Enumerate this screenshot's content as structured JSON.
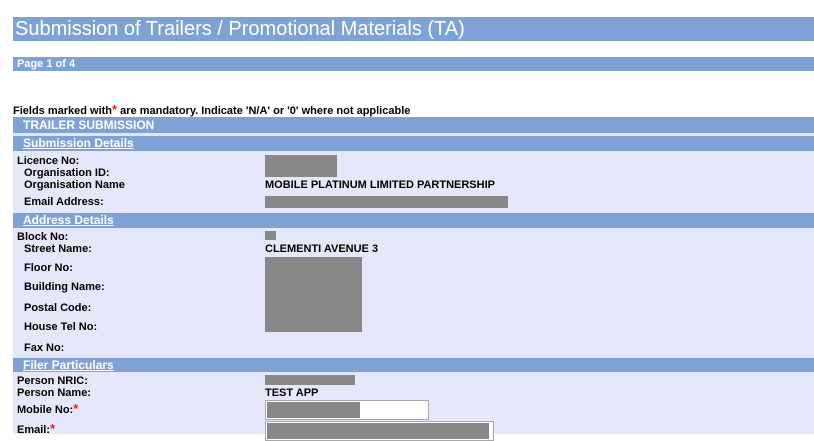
{
  "title": "Submission of Trailers / Promotional Materials (TA)",
  "page_indicator": "Page 1 of 4",
  "mandatory_note": {
    "prefix": "Fields marked with",
    "star": "*",
    "suffix": " are mandatory. Indicate 'N/A' or '0' where not applicable"
  },
  "section_title": "TRAILER SUBMISSION",
  "submission_details": {
    "header": "Submission Details",
    "labels": {
      "licence_no": "Licence No:",
      "organisation_id": "Organisation ID:",
      "organisation_name": "Organisation Name",
      "email_address": "Email Address:"
    },
    "values": {
      "organisation_name": "MOBILE PLATINUM LIMITED PARTNERSHIP"
    }
  },
  "address_details": {
    "header": "Address Details",
    "labels": {
      "block_no": "Block No:",
      "street_name": "Street Name:",
      "floor_no": "Floor No:",
      "building_name": "Building Name:",
      "postal_code": "Postal Code:",
      "house_tel_no": "House Tel No:",
      "fax_no": "Fax No:"
    },
    "values": {
      "street_name": "CLEMENTI AVENUE 3"
    }
  },
  "filer_particulars": {
    "header": "Filer Particulars",
    "labels": {
      "person_nric": "Person NRIC:",
      "person_name": "Person Name:",
      "mobile_no": "Mobile No:",
      "email": "Email:"
    },
    "required_star": "*",
    "values": {
      "person_name": "TEST APP"
    }
  },
  "colors": {
    "header_bg": "#7ea1d6",
    "form_bg": "#e7e7fb",
    "required": "#e0261c",
    "redaction": "#888888"
  }
}
